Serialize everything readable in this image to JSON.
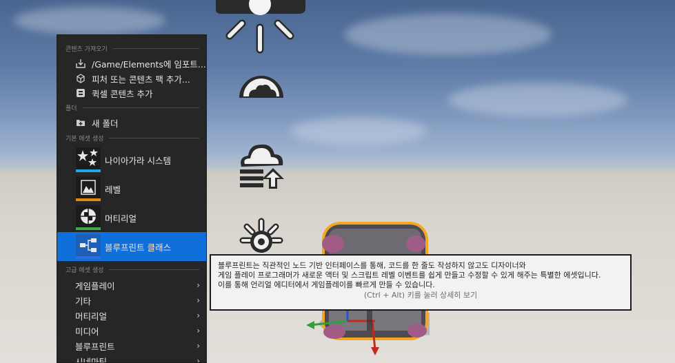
{
  "menu": {
    "sections": {
      "import": "콘텐츠 가져오기",
      "folder": "폴더",
      "basic_assets": "기본 에셋 생성",
      "advanced_assets": "고급 에셋 생성"
    },
    "import_items": [
      {
        "label": "/Game/Elements에 임포트...",
        "icon": "import-icon"
      },
      {
        "label": "피처 또는 콘텐츠 팩 추가...",
        "icon": "feature-pack-icon"
      },
      {
        "label": "퀵셀 콘텐츠 추가",
        "icon": "quixel-icon"
      }
    ],
    "folder_items": [
      {
        "label": "새 폴더",
        "icon": "new-folder-icon"
      }
    ],
    "basic_assets": [
      {
        "label": "나이아가라 시스템",
        "accent": "#1ea8e6",
        "icon": "niagara-icon"
      },
      {
        "label": "레벨",
        "accent": "#e08a10",
        "icon": "level-icon"
      },
      {
        "label": "머티리얼",
        "accent": "#3fa64a",
        "icon": "material-icon"
      },
      {
        "label": "블루프린트 클래스",
        "accent": "#2f6fd6",
        "icon": "blueprint-class-icon",
        "selected": true
      }
    ],
    "advanced_assets": [
      {
        "label": "게임플레이"
      },
      {
        "label": "기타"
      },
      {
        "label": "머티리얼"
      },
      {
        "label": "미디어"
      },
      {
        "label": "블루프린트"
      },
      {
        "label": "시네마틱"
      }
    ]
  },
  "tooltip": {
    "line1": "블루프린트는 직관적인 노드 기반 인터페이스를 통해, 코드를 한 줄도 작성하지 않고도 디자이너와",
    "line2": "게임 플레이 프로그래머가 새로운 액터 및 스크립트 레벨 이벤트를 쉽게 만들고 수정할 수 있게 해주는 특별한 에셋입니다.",
    "line3": "이를 통해 언리얼 에디터에서 게임플레이를 빠르게 만들 수 있습니다.",
    "hint": "(Ctrl + Alt) 키를 눌러 상세히 보기"
  },
  "colors": {
    "menu_bg": "#262626",
    "selected": "#0f6fdb",
    "tooltip_bg": "#f2f2f2",
    "selection_outline": "#f5a623"
  }
}
